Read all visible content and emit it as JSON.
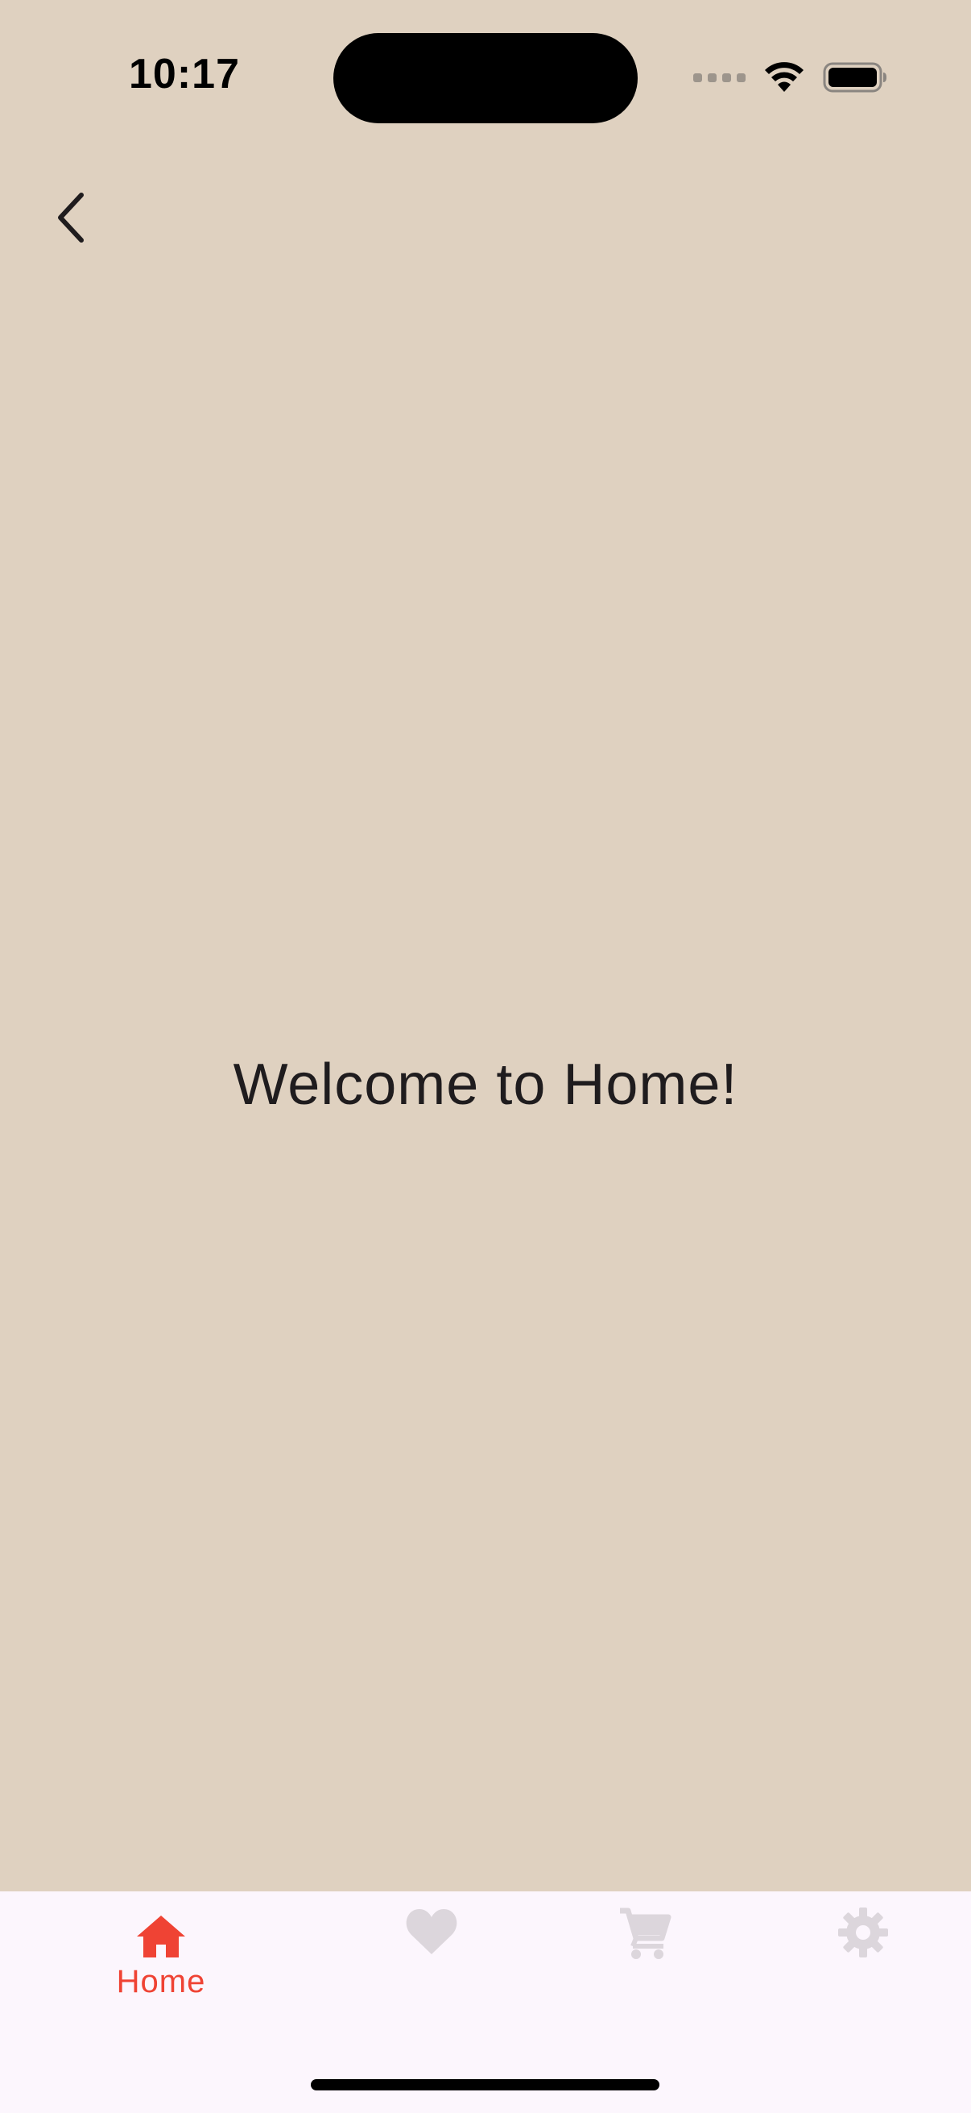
{
  "status_bar": {
    "time": "10:17"
  },
  "nav": {
    "back_icon": "chevron-left-icon"
  },
  "main": {
    "welcome_text": "Welcome to Home!"
  },
  "tab_bar": {
    "tabs": [
      {
        "name": "home",
        "label": "Home",
        "icon": "home-icon",
        "active": true
      },
      {
        "name": "favorites",
        "label": "",
        "icon": "heart-icon",
        "active": false
      },
      {
        "name": "cart",
        "label": "",
        "icon": "cart-icon",
        "active": false
      },
      {
        "name": "settings",
        "label": "",
        "icon": "gear-icon",
        "active": false
      }
    ]
  },
  "colors": {
    "background": "#dfd1c0",
    "tab_bar_background": "#fcf6fd",
    "active_tab": "#ef4334",
    "inactive_tab": "#dcd6dc",
    "text": "#1f1c1e"
  }
}
